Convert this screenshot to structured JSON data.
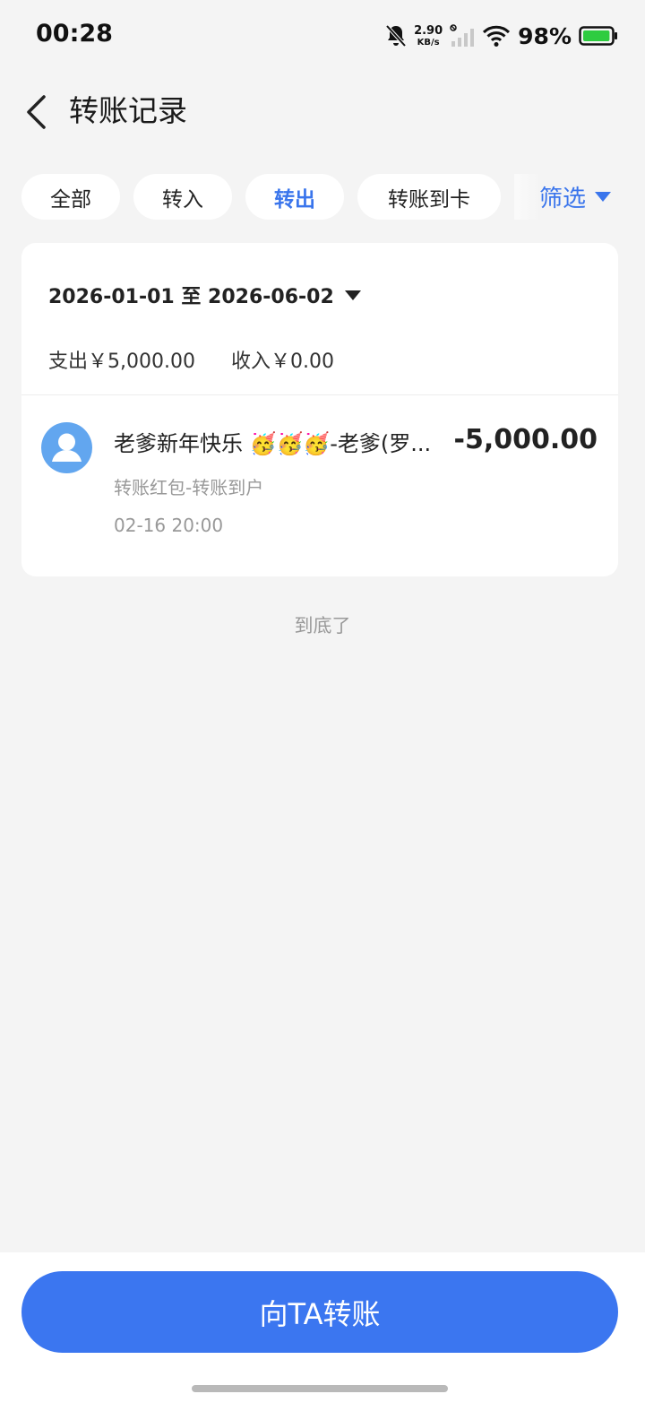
{
  "status_bar": {
    "time": "00:28",
    "net_speed_value": "2.90",
    "net_speed_unit": "KB/s",
    "battery_percent": "98%",
    "icons": [
      "bell-off-icon",
      "signal-icon",
      "wifi-icon",
      "battery-icon"
    ],
    "battery_level": 0.98
  },
  "header": {
    "title": "转账记录",
    "back_icon": "chevron-left-icon"
  },
  "tabs": [
    {
      "label": "全部",
      "active": false
    },
    {
      "label": "转入",
      "active": false
    },
    {
      "label": "转出",
      "active": true
    },
    {
      "label": "转账到卡",
      "active": false
    }
  ],
  "filter": {
    "label": "筛选",
    "icon": "triangle-down-icon"
  },
  "summary": {
    "date_range": "2026-01-01 至 2026-06-02",
    "expense": "支出￥5,000.00",
    "income": "收入￥0.00"
  },
  "records": [
    {
      "title": "老爹新年快乐 🥳🥳🥳-老爹(罗...",
      "amount": "-5,000.00",
      "type": "转账红包-转账到户",
      "time": "02-16 20:00",
      "avatar_icon": "user-avatar-icon"
    }
  ],
  "end_hint": "到底了",
  "primary_button": {
    "label": "向TA转账"
  },
  "colors": {
    "accent": "#3b76f0",
    "avatar": "#62a6ef",
    "background": "#f4f4f4"
  }
}
